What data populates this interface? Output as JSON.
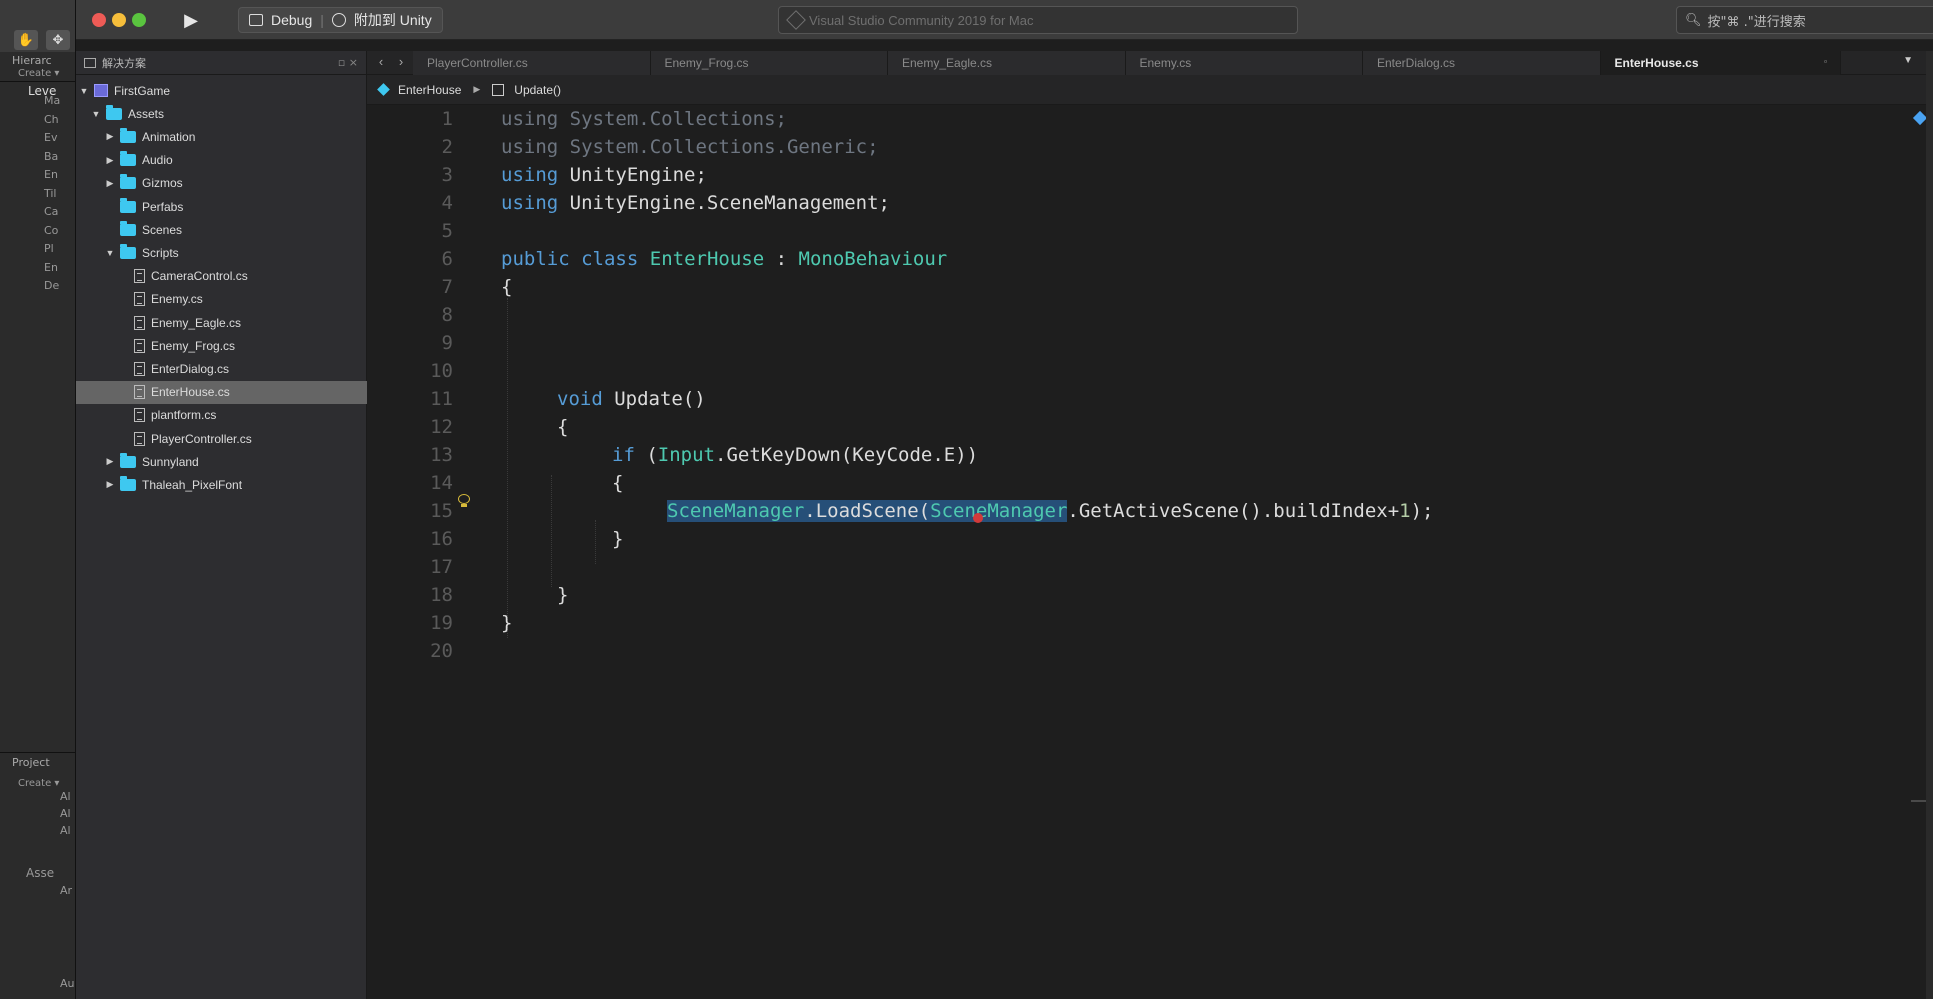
{
  "unity": {
    "hierarchy_title": "Hierarc",
    "create_label": "Create",
    "scene_name": "Leve",
    "hierarchy_items": [
      "Ma",
      "Ch",
      "Ev",
      "Ba",
      "En",
      "Til",
      "Ca",
      "Co",
      "Pl",
      "En",
      "De"
    ],
    "project_title": "Project",
    "project_create": "Create",
    "favorites": [
      "Al",
      "Al",
      "Al"
    ],
    "assets_title": "Asse",
    "assets_items": [
      "Ar",
      "",
      "",
      "",
      "",
      "Au"
    ]
  },
  "titlebar": {
    "config_label": "Debug",
    "attach_label": "附加到 Unity",
    "status_text": "Visual Studio Community 2019 for Mac",
    "search_placeholder": "按\"⌘ .\"进行搜索"
  },
  "solution": {
    "title": "解决方案",
    "root": "FirstGame",
    "assets": "Assets",
    "folders_top": [
      "Animation",
      "Audio",
      "Gizmos",
      "Perfabs",
      "Scenes",
      "Scripts"
    ],
    "scripts": [
      "CameraControl.cs",
      "Enemy.cs",
      "Enemy_Eagle.cs",
      "Enemy_Frog.cs",
      "EnterDialog.cs",
      "EnterHouse.cs",
      "plantform.cs",
      "PlayerController.cs"
    ],
    "folders_bottom": [
      "Sunnyland",
      "Thaleah_PixelFont"
    ],
    "selected_file": "EnterHouse.cs"
  },
  "tabs": [
    "PlayerController.cs",
    "Enemy_Frog.cs",
    "Enemy_Eagle.cs",
    "Enemy.cs",
    "EnterDialog.cs",
    "EnterHouse.cs"
  ],
  "active_tab": "EnterHouse.cs",
  "breadcrumb": {
    "class_name": "EnterHouse",
    "method_name": "Update()"
  },
  "code": {
    "line_numbers": [
      "1",
      "2",
      "3",
      "4",
      "5",
      "6",
      "7",
      "8",
      "9",
      "10",
      "11",
      "12",
      "13",
      "14",
      "15",
      "16",
      "17",
      "18",
      "19",
      "20"
    ],
    "using_kw": "using",
    "l1_ns": "System.Collections;",
    "l2_ns": "System.Collections.Generic;",
    "l3_ns": "UnityEngine;",
    "l4_ns": "UnityEngine.SceneManagement;",
    "l6_public": "public",
    "l6_class": "class",
    "l6_name": "EnterHouse",
    "l6_colon": ":",
    "l6_base": "MonoBehaviour",
    "open_brace": "{",
    "close_brace": "}",
    "l11_void": "void",
    "l11_method": "Update()",
    "l13_if": "if",
    "l13_open": "(",
    "l13_input": "Input",
    "l13_rest": ".GetKeyDown(KeyCode.E))",
    "l15_scene1": "SceneManager",
    "l15_mid": ".LoadScene(",
    "l15_scene2": "SceneManager",
    "l15_rest": ".GetActiveScene().buildIndex+",
    "l15_num": "1",
    "l15_end": ");"
  },
  "colors": {
    "keyword": "#569cd6",
    "type": "#4ec9b0",
    "number": "#b5cea8",
    "folder": "#3ec8f0",
    "selection": "#264f78"
  }
}
